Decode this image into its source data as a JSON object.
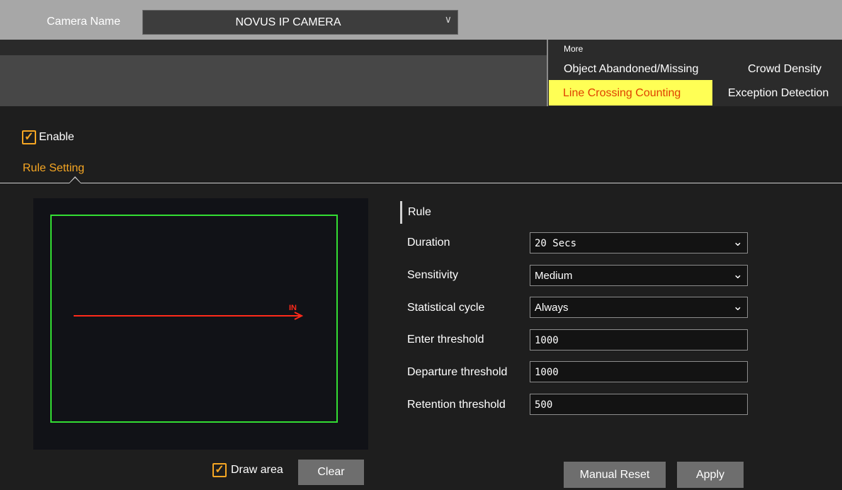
{
  "header": {
    "camera_name_label": "Camera Name",
    "camera_name_value": "NOVUS IP CAMERA"
  },
  "tabs": {
    "more_label": "More",
    "items": [
      {
        "label": "Object Abandoned/Missing",
        "active": false
      },
      {
        "label": "Crowd Density",
        "active": false
      },
      {
        "label": "Line Crossing Counting",
        "active": true
      },
      {
        "label": "Exception Detection",
        "active": false
      }
    ]
  },
  "enable": {
    "label": "Enable",
    "checked": true
  },
  "rule_setting_tab": "Rule Setting",
  "preview": {
    "line_label": "IN",
    "draw_area": {
      "label": "Draw area",
      "checked": true
    },
    "clear_label": "Clear"
  },
  "rule": {
    "heading": "Rule",
    "duration": {
      "label": "Duration",
      "value": "20 Secs"
    },
    "sensitivity": {
      "label": "Sensitivity",
      "value": "Medium"
    },
    "statistical_cycle": {
      "label": "Statistical cycle",
      "value": "Always"
    },
    "enter_threshold": {
      "label": "Enter threshold",
      "value": "1000"
    },
    "departure_threshold": {
      "label": "Departure threshold",
      "value": "1000"
    },
    "retention_threshold": {
      "label": "Retention threshold",
      "value": "500"
    }
  },
  "actions": {
    "manual_reset_label": "Manual Reset",
    "apply_label": "Apply"
  },
  "colors": {
    "accent": "#f5a623",
    "active_tab_bg": "#ffff55",
    "active_tab_text": "#e04000",
    "area_box": "#33dd33",
    "crossing_line": "#ff2a1a"
  }
}
